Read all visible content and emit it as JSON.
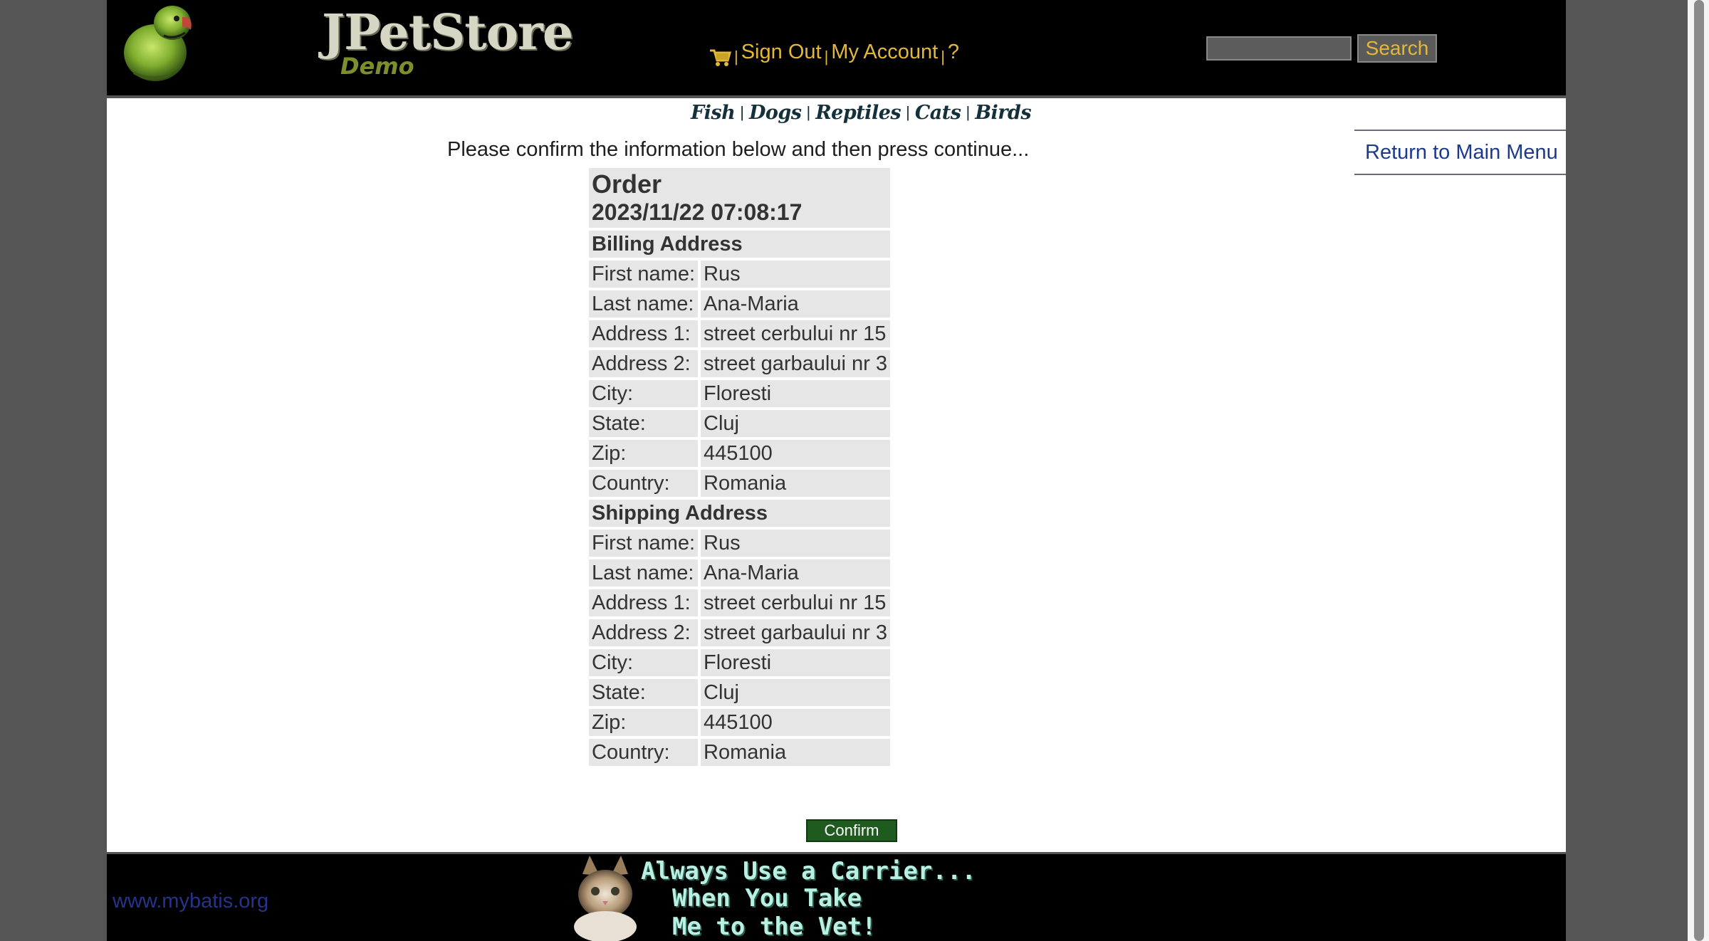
{
  "header": {
    "logo_title": "JPetStore",
    "logo_subtitle": "Demo",
    "menu": {
      "sign_out": "Sign Out",
      "my_account": "My Account",
      "help": "?",
      "separator": "|"
    },
    "search": {
      "input_value": "",
      "button_label": "Search"
    }
  },
  "quicklinks": [
    "Fish",
    "Dogs",
    "Reptiles",
    "Cats",
    "Birds"
  ],
  "return_link": "Return to Main Menu",
  "confirm_message": "Please confirm the information below and then press continue...",
  "order": {
    "title": "Order",
    "date": "2023/11/22 07:08:17",
    "billing": {
      "heading": "Billing Address",
      "rows": [
        {
          "label": "First name:",
          "value": "Rus"
        },
        {
          "label": "Last name:",
          "value": "Ana-Maria"
        },
        {
          "label": "Address 1:",
          "value": "street cerbului nr 15"
        },
        {
          "label": "Address 2:",
          "value": "street garbaului nr 3"
        },
        {
          "label": "City:",
          "value": "Floresti"
        },
        {
          "label": "State:",
          "value": "Cluj"
        },
        {
          "label": "Zip:",
          "value": "445100"
        },
        {
          "label": "Country:",
          "value": "Romania"
        }
      ]
    },
    "shipping": {
      "heading": "Shipping Address",
      "rows": [
        {
          "label": "First name:",
          "value": "Rus"
        },
        {
          "label": "Last name:",
          "value": "Ana-Maria"
        },
        {
          "label": "Address 1:",
          "value": "street cerbului nr 15"
        },
        {
          "label": "Address 2:",
          "value": "street garbaului nr 3"
        },
        {
          "label": "City:",
          "value": "Floresti"
        },
        {
          "label": "State:",
          "value": "Cluj"
        },
        {
          "label": "Zip:",
          "value": "445100"
        },
        {
          "label": "Country:",
          "value": "Romania"
        }
      ]
    },
    "confirm_button": "Confirm"
  },
  "footer": {
    "link": "www.mybatis.org",
    "banner_lines": [
      "Always Use a Carrier...",
      "When You Take",
      "Me to the Vet!"
    ]
  },
  "icons": {
    "cart": "cart-icon",
    "parrot": "parrot-logo-icon",
    "cat": "cat-photo-icon"
  },
  "colors": {
    "header_bg": "#000000",
    "menu_link": "#e2b83a",
    "link_blue": "#1c3a8c",
    "confirm_green": "#1f5b1f",
    "table_cell": "#e6e6e6",
    "side_gray": "#555555"
  }
}
